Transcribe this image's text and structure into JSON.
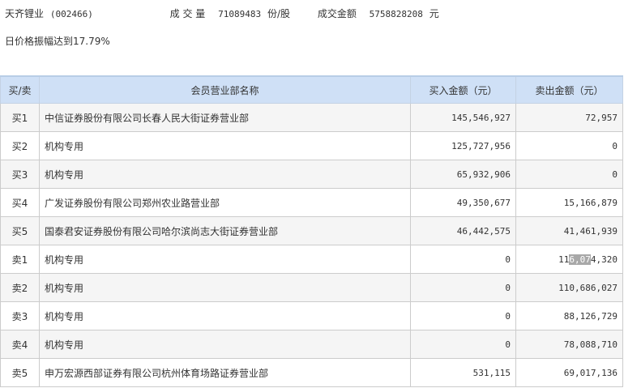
{
  "header": {
    "stock_name": "天齐锂业",
    "stock_code": "(002466)",
    "volume_label": "成 交 量",
    "volume": "71089483",
    "volume_unit": "份/股",
    "amount_label": "成交金额",
    "amount": "5758828208",
    "amount_unit": "元"
  },
  "amplitude": "日价格振幅达到17.79%",
  "table": {
    "headers": [
      "买/卖",
      "会员营业部名称",
      "买入金额（元）",
      "卖出金额（元）"
    ],
    "rows": [
      {
        "side": "买1",
        "name": "中信证券股份有限公司长春人民大街证券营业部",
        "buy": "145,546,927",
        "sell": "72,957"
      },
      {
        "side": "买2",
        "name": "机构专用",
        "buy": "125,727,956",
        "sell": "0"
      },
      {
        "side": "买3",
        "name": "机构专用",
        "buy": "65,932,906",
        "sell": "0"
      },
      {
        "side": "买4",
        "name": "广发证券股份有限公司郑州农业路营业部",
        "buy": "49,350,677",
        "sell": "15,166,879"
      },
      {
        "side": "买5",
        "name": "国泰君安证券股份有限公司哈尔滨尚志大街证券营业部",
        "buy": "46,442,575",
        "sell": "41,461,939"
      },
      {
        "side": "卖1",
        "name": "机构专用",
        "buy": "0",
        "sell_a": "11",
        "sell_hl": "6,07",
        "sell_b": "4,320"
      },
      {
        "side": "卖2",
        "name": "机构专用",
        "buy": "0",
        "sell": "110,686,027"
      },
      {
        "side": "卖3",
        "name": "机构专用",
        "buy": "0",
        "sell": "88,126,729"
      },
      {
        "side": "卖4",
        "name": "机构专用",
        "buy": "0",
        "sell": "78,088,710"
      },
      {
        "side": "卖5",
        "name": "申万宏源西部证券有限公司杭州体育场路证券营业部",
        "buy": "531,115",
        "sell": "69,017,136"
      }
    ]
  }
}
